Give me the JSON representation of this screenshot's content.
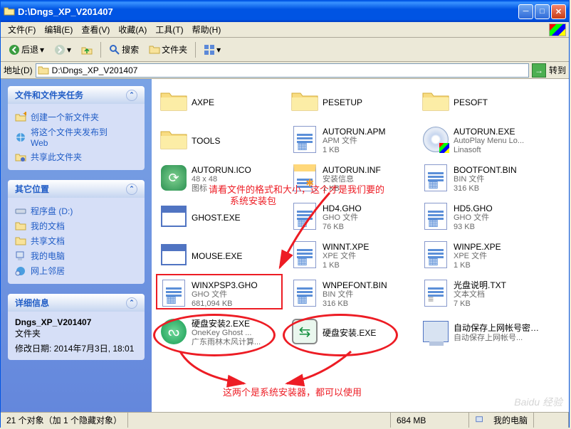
{
  "window": {
    "title": "D:\\Dngs_XP_V201407"
  },
  "menu": {
    "file": "文件(F)",
    "edit": "编辑(E)",
    "view": "查看(V)",
    "fav": "收藏(A)",
    "tools": "工具(T)",
    "help": "帮助(H)"
  },
  "toolbar": {
    "back": "后退",
    "search": "搜索",
    "folders": "文件夹"
  },
  "address": {
    "label": "地址(D)",
    "value": "D:\\Dngs_XP_V201407",
    "go": "转到"
  },
  "sidebar": {
    "tasks": {
      "title": "文件和文件夹任务",
      "new_folder": "创建一个新文件夹",
      "publish": "将这个文件夹发布到\nWeb",
      "share": "共享此文件夹"
    },
    "other": {
      "title": "其它位置",
      "disk": "程序盘 (D:)",
      "mydocs": "我的文档",
      "shared": "共享文档",
      "mycomp": "我的电脑",
      "network": "网上邻居"
    },
    "details": {
      "title": "详细信息",
      "name": "Dngs_XP_V201407",
      "type": "文件夹",
      "modified": "修改日期: 2014年7月3日, 18:01"
    }
  },
  "files": [
    {
      "name": "AXPE",
      "kind": "folder"
    },
    {
      "name": "PESETUP",
      "kind": "folder"
    },
    {
      "name": "PESOFT",
      "kind": "folder"
    },
    {
      "name": "TOOLS",
      "kind": "folder"
    },
    {
      "name": "AUTORUN.APM",
      "meta1": "APM 文件",
      "meta2": "1 KB",
      "kind": "doc-grid"
    },
    {
      "name": "AUTORUN.EXE",
      "meta1": "AutoPlay Menu Lo...",
      "meta2": "Linasoft",
      "kind": "cd"
    },
    {
      "name": "AUTORUN.ICO",
      "meta1": "48 x 48",
      "meta2": "图标",
      "kind": "ico"
    },
    {
      "name": "AUTORUN.INF",
      "meta1": "安装信息",
      "meta2": "1 KB",
      "kind": "gear-note"
    },
    {
      "name": "BOOTFONT.BIN",
      "meta1": "BIN 文件",
      "meta2": "316 KB",
      "kind": "doc-grid"
    },
    {
      "name": "GHOST.EXE",
      "kind": "exe"
    },
    {
      "name": "HD4.GHO",
      "meta1": "GHO 文件",
      "meta2": "76 KB",
      "kind": "doc-grid"
    },
    {
      "name": "HD5.GHO",
      "meta1": "GHO 文件",
      "meta2": "93 KB",
      "kind": "doc-grid"
    },
    {
      "name": "MOUSE.EXE",
      "kind": "exe"
    },
    {
      "name": "WINNT.XPE",
      "meta1": "XPE 文件",
      "meta2": "1 KB",
      "kind": "doc-grid"
    },
    {
      "name": "WINPE.XPE",
      "meta1": "XPE 文件",
      "meta2": "1 KB",
      "kind": "doc-grid"
    },
    {
      "name": "WINXPSP3.GHO",
      "meta1": "GHO 文件",
      "meta2": "681,094 KB",
      "kind": "doc-grid"
    },
    {
      "name": "WNPEFONT.BIN",
      "meta1": "BIN 文件",
      "meta2": "316 KB",
      "kind": "doc-grid"
    },
    {
      "name": "光盘说明.TXT",
      "meta1": "文本文档",
      "meta2": "7 KB",
      "kind": "txt"
    },
    {
      "name": "硬盘安装2.EXE",
      "meta1": "OneKey Ghost ...",
      "meta2": "广东雨林木风计算...",
      "kind": "green"
    },
    {
      "name": "硬盘安装.EXE",
      "kind": "arrows"
    },
    {
      "name": "自动保存上网帐号密码到U盘.EXE",
      "meta1": "自动保存上网帐号...",
      "kind": "pc"
    }
  ],
  "annotations": {
    "text1a": "请看文件的格式和大小，这个才是我们要的",
    "text1b": "系统安装包",
    "text2": "这两个是系统安装器，都可以使用"
  },
  "status": {
    "objects": "21 个对象（加 1 个隐藏对象）",
    "size": "684 MB",
    "location": "我的电脑"
  },
  "watermark": "Baidu 经验"
}
